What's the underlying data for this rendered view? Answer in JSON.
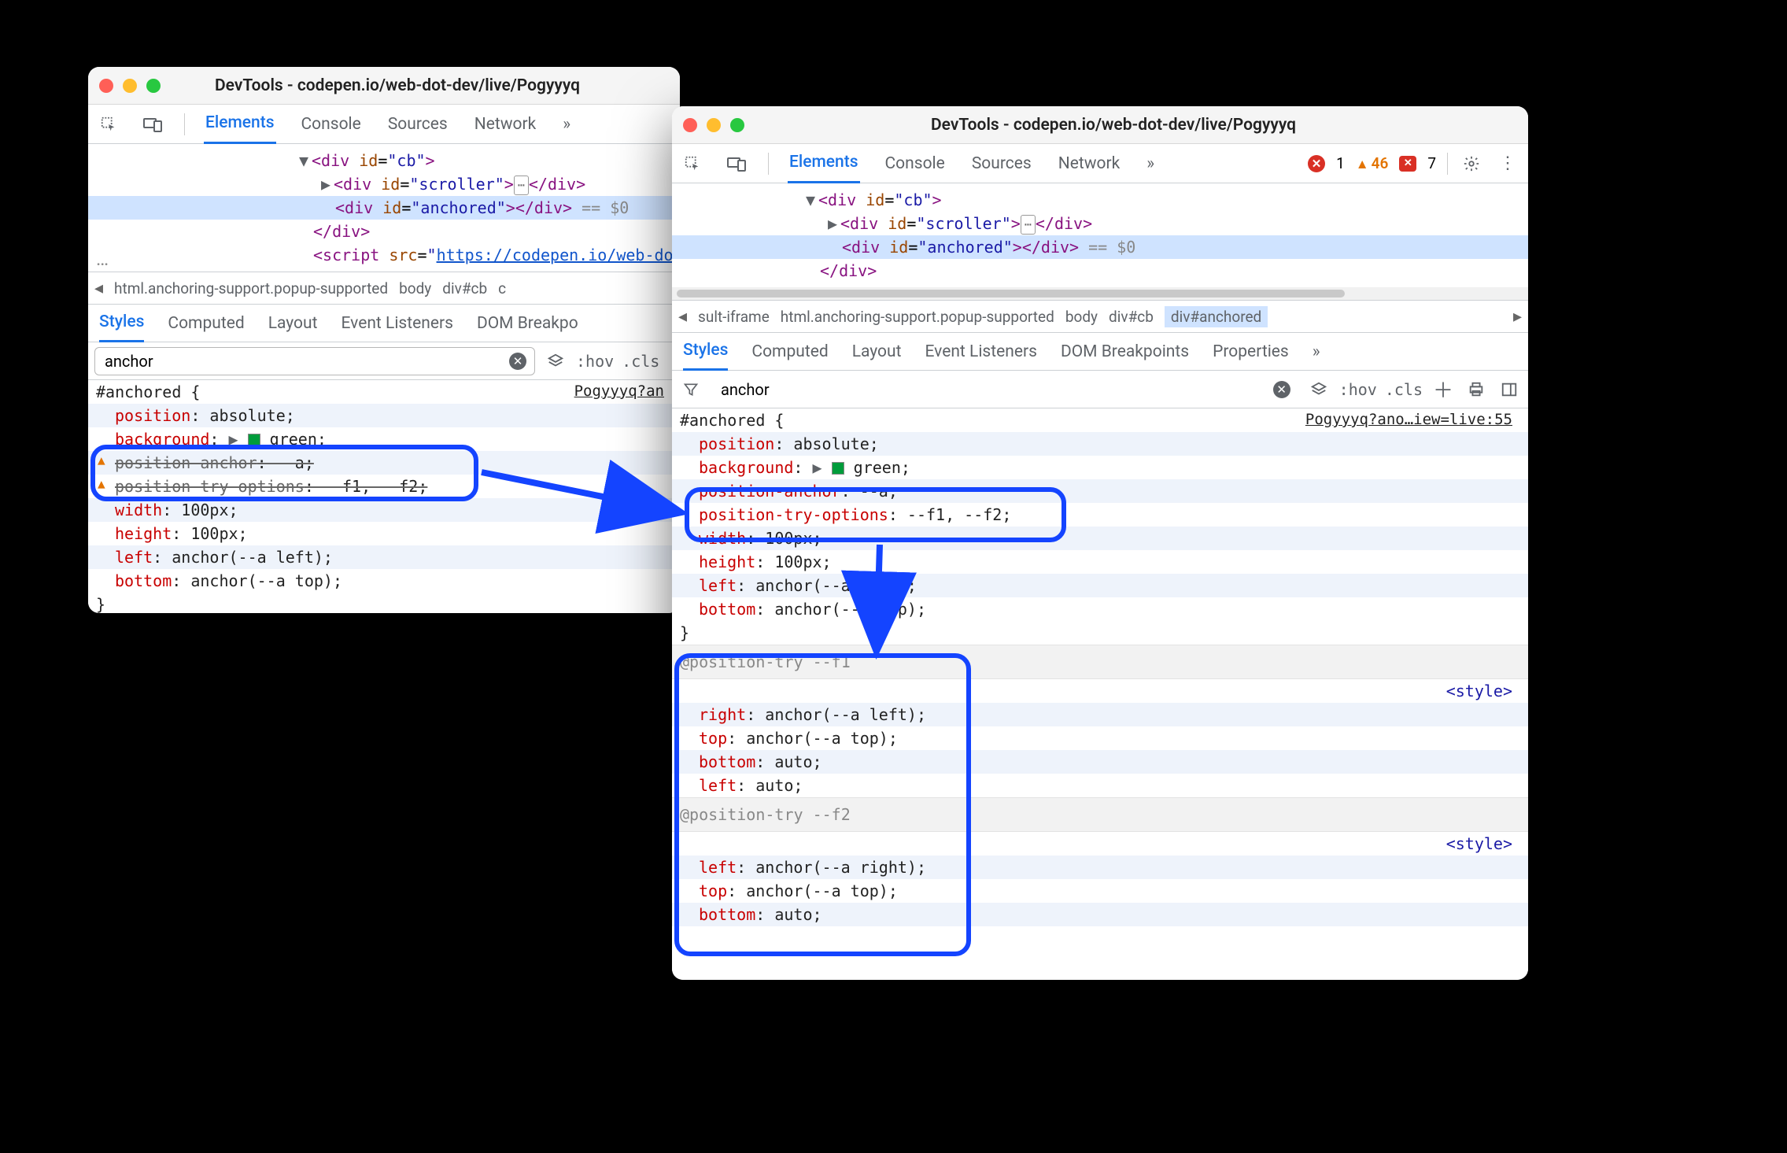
{
  "window_title": "DevTools - codepen.io/web-dot-dev/live/Pogyyyq",
  "toolbar_tabs": {
    "elements": "Elements",
    "console": "Console",
    "sources": "Sources",
    "network": "Network",
    "more": "»"
  },
  "status": {
    "errors": "1",
    "warnings": "46",
    "violations": "7"
  },
  "dom": {
    "open_div_cb": "<div id=\"cb\">",
    "scroller_open": "<div id=\"scroller\">",
    "scroller_close": "</div>",
    "anchored": "<div id=\"anchored\"></div>",
    "eq0": " == $0",
    "div_close": "</div>",
    "script_open": "<script src=\"",
    "script_url": "https://codepen.io/web-dot-d"
  },
  "crumbs_left": {
    "c1": "html.anchoring-support.popup-supported",
    "c2": "body",
    "c3": "div#cb",
    "partial": "c"
  },
  "crumbs_right": {
    "c0": "sult-iframe",
    "c1": "html.anchoring-support.popup-supported",
    "c2": "body",
    "c3": "div#cb",
    "c4": "div#anchored"
  },
  "pane_tabs": {
    "styles": "Styles",
    "computed": "Computed",
    "layout": "Layout",
    "events": "Event Listeners",
    "dom": "DOM Breakpoints",
    "props": "Properties",
    "more": "»"
  },
  "pane_tabs_left_dom": "DOM Breakpo",
  "filter": {
    "value": "anchor",
    "hov": ":hov",
    "cls": ".cls"
  },
  "styles_shared": {
    "selector": "#anchored {",
    "src_left": "Pogyyyq?an",
    "src_right": "Pogyyyq?ano…iew=live:55",
    "position_n": "position",
    "position_v": ": absolute;",
    "background_n": "background",
    "background_v": ": ",
    "background_v2": "green;",
    "pa_n": "position-anchor",
    "pa_v": ": --a;",
    "pto_n": "position-try-options",
    "pto_v": ": --f1, --f2;",
    "width_n": "width",
    "width_v": ": 100px;",
    "height_n": "height",
    "height_v": ": 100px;",
    "left_n": "left",
    "left_v": ": anchor(--a left);",
    "bottom_n": "bottom",
    "bottom_v": ": anchor(--a top);",
    "brace": "}"
  },
  "position_try": {
    "f1_hdr": "@position-try --f1",
    "f2_hdr": "@position-try --f2",
    "stylelink": "<style>",
    "right_n": "right",
    "right_v": ": anchor(--a left);",
    "top_n": "top",
    "top_v": ": anchor(--a top);",
    "bottom_n": "bottom",
    "bottom_v": ": auto;",
    "left_n": "left",
    "left_v": ": auto;",
    "f2_left_n": "left",
    "f2_left_v": ": anchor(--a right);",
    "f2_top_n": "top",
    "f2_top_v": ": anchor(--a top);",
    "f2_bottom_n": "bottom",
    "f2_bottom_v": ": auto;"
  }
}
